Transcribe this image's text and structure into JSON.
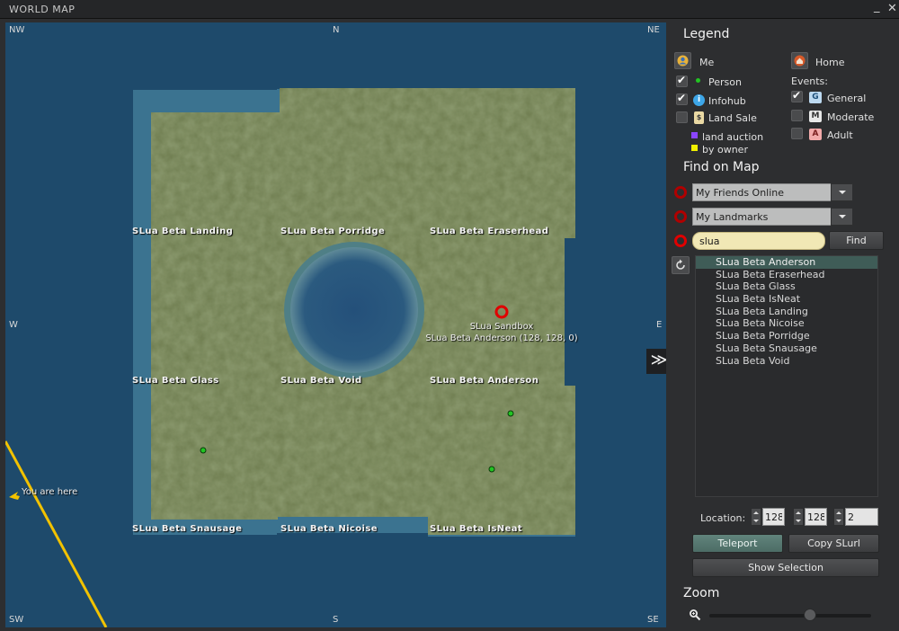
{
  "window": {
    "title": "WORLD MAP",
    "minimize_glyph": "_",
    "close_glyph": "✕"
  },
  "map": {
    "compass": {
      "nw": "NW",
      "n": "N",
      "ne": "NE",
      "w": "W",
      "e": "E",
      "sw": "SW",
      "s": "S",
      "se": "SE"
    },
    "regions": [
      {
        "name": "SLua Beta Landing"
      },
      {
        "name": "SLua Beta Porridge"
      },
      {
        "name": "SLua Beta Eraserhead"
      },
      {
        "name": "SLua Beta Glass"
      },
      {
        "name": "SLua Beta Void"
      },
      {
        "name": "SLua Beta Anderson"
      },
      {
        "name": "SLua Beta Snausage"
      },
      {
        "name": "SLua Beta Nicoise"
      },
      {
        "name": "SLua Beta IsNeat"
      }
    ],
    "marker": {
      "title": "SLua Sandbox",
      "subtitle": "SLua Beta Anderson (128, 128, 0)"
    },
    "you_are_here": "You are here",
    "collapse_glyph": "≫",
    "colors": {
      "water": "#1e4a6b",
      "land": "#6b7a4c",
      "marker": "#e00000",
      "person": "#22c422",
      "track": "#f0c000"
    }
  },
  "legend": {
    "title": "Legend",
    "me": "Me",
    "home": "Home",
    "person": {
      "label": "Person",
      "checked": true
    },
    "infohub": {
      "label": "Infohub",
      "checked": true
    },
    "land_sale": {
      "label": "Land Sale",
      "checked": false
    },
    "land_auction": "land auction",
    "by_owner": "by owner",
    "events_label": "Events:",
    "general": {
      "label": "General",
      "badge": "G",
      "checked": true
    },
    "moderate": {
      "label": "Moderate",
      "badge": "M",
      "checked": false
    },
    "adult": {
      "label": "Adult",
      "badge": "A",
      "checked": false
    }
  },
  "find": {
    "title": "Find on Map",
    "friends_combo": "My Friends Online",
    "landmarks_combo": "My Landmarks",
    "search_value": "slua",
    "find_button": "Find",
    "results": [
      "SLua Beta Anderson",
      "SLua Beta Eraserhead",
      "SLua Beta Glass",
      "SLua Beta IsNeat",
      "SLua Beta Landing",
      "SLua Beta Nicoise",
      "SLua Beta Porridge",
      "SLua Beta Snausage",
      "SLua Beta Void"
    ],
    "selected_index": 0
  },
  "location": {
    "label": "Location:",
    "x": "128",
    "y": "128",
    "z": "2"
  },
  "buttons": {
    "teleport": "Teleport",
    "copy_slurl": "Copy SLurl",
    "show_selection": "Show Selection"
  },
  "zoom": {
    "title": "Zoom",
    "level": 0.62
  }
}
